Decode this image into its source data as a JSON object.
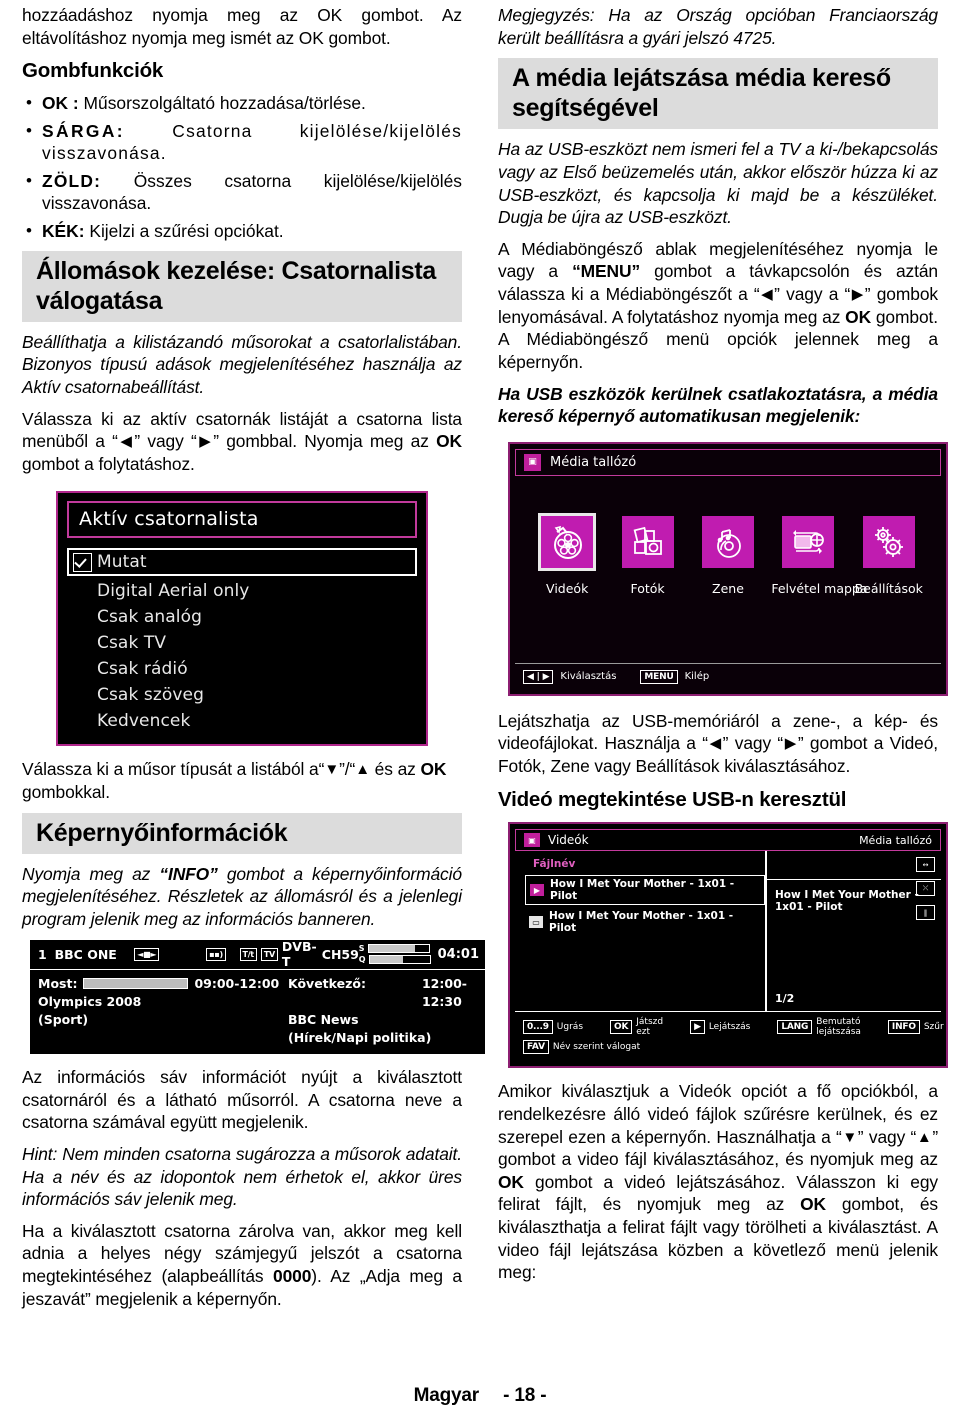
{
  "left": {
    "intro_paragraph": "hozzáadáshoz nyomja meg az OK gombot. Az eltávolításhoz nyomja meg ismét az OK gombot.",
    "button_functions_heading": "Gombfunkciók",
    "button_items": [
      {
        "key": "OK :",
        "text": " Műsorszolgáltató hozzadása/törlése."
      },
      {
        "key": "SÁRGA:",
        "text": " Csatorna kijelölése/kijelölés visszavonása."
      },
      {
        "key": "ZÖLD:",
        "text": " Összes csatorna kijelölése/kijelölés visszavonása."
      },
      {
        "key": "KÉK:",
        "text": " Kijelzi a szűrési opciókat."
      }
    ],
    "section_heading": "Állomások kezelése: Csatornalista válogatása",
    "para_italic_1": "Beállíthatja a kilistázandó műsorokat a csatorlalistában. Bizonyos típusú adások megjelenítéséhez használja az Aktív csatornabeállítást.",
    "para_2_a": "Válassza ki az aktív csatornák listáját a csatorna lista menüből a “",
    "para_2_b": "” vagy “",
    "para_2_c": "” gombbal. Nyomja meg az ",
    "para_2_ok": "OK",
    "para_2_d": " gombot a folytatáshoz.",
    "active_list_screenshot": {
      "title": "Aktív csatornalista",
      "options": [
        {
          "label": "Mutat",
          "selected": true,
          "checked": true
        },
        {
          "label": "Digital Aerial only",
          "selected": false,
          "checked": false
        },
        {
          "label": "Csak analóg",
          "selected": false,
          "checked": false
        },
        {
          "label": "Csak TV",
          "selected": false,
          "checked": false
        },
        {
          "label": "Csak rádió",
          "selected": false,
          "checked": false
        },
        {
          "label": "Csak szöveg",
          "selected": false,
          "checked": false
        },
        {
          "label": "Kedvencek",
          "selected": false,
          "checked": false
        }
      ]
    },
    "para_3_a": "Válassza ki a műsor típusát a listából a“",
    "para_3_b": "”/“",
    "para_3_c": " és az ",
    "para_3_ok": "OK",
    "para_3_d": " gombokkal.",
    "screen_info_heading": "Képernyőinformációk",
    "para_info_a": "Nyomja meg az ",
    "para_info_bold": "“INFO”",
    "para_info_b": " gombot a képernyőinformáció megjelenítéséhez. Részletek az állomásról és a jelenlegi program jelenik meg az információs banneren.",
    "banner_screenshot": {
      "channel_number": "1",
      "channel_name": "BBC ONE",
      "icons": [
        "stereo-icon",
        "subtitle-icon",
        "teletext-icon",
        "tv-icon"
      ],
      "teletext_label": "T/t",
      "tv_label": "TV",
      "broadcast_type": "DVB-T",
      "channel_id": "CH59",
      "signal_label": "S",
      "quality_label": "Q",
      "signal_percent": 78,
      "quality_percent": 55,
      "clock": "04:01",
      "now_label": "Most:",
      "now_time": "09:00-12:00",
      "now_title": "Olympics 2008",
      "now_genre": "(Sport)",
      "next_label": "Következő:",
      "next_time": "12:00-12:30",
      "next_title": "BBC News",
      "next_genre": "(Hírek/Napi politika)",
      "progress_percent": 100
    },
    "para_4": "Az információs sáv információt nyújt a kiválasztott csatornáról és a látható műsorról. A csatorna neve a csatorna számával együtt megjelenik.",
    "para_hint": "Hint: Nem minden csatorna sugározza a műsorok adatait. Ha a név és az idopontok nem érhetok el, akkor üres információs sáv jelenik meg.",
    "para_5_a": "Ha a kiválasztott csatorna zárolva van, akkor meg kell adnia a helyes négy számjegyű jelszót a csatorna megtekintéséhez (alapbeállítás ",
    "para_5_code": "0000",
    "para_5_b": "). Az „Adja meg a jeszavát” megjelenik a képernyőn."
  },
  "right": {
    "note_paragraph": "Megjegyzés: Ha az Ország opcióban Franciaország került beállításra a gyári jelszó 4725.",
    "section_heading": "A média lejátszása média kereső segítségével",
    "para_italic_1": "Ha az USB-eszközt nem ismeri fel a TV a ki-/bekapcsolás vagy az Első beüzemelés után, akkor először húzza ki az USB-eszközt, és kapcsolja ki majd be a készüléket. Dugja be újra az USB-eszközt.",
    "para_2_a": "A Médiaböngésző ablak megjelenítéséhez nyomja le vagy a ",
    "para_2_menu": "“MENU”",
    "para_2_b": " gombot a távkapcsolón és aztán válassza ki a Médiaböngészőt a “",
    "para_2_c": "” vagy a “",
    "para_2_d": "” gombok lenyomásával. A folytatáshoz nyomja meg az ",
    "para_2_ok": "OK",
    "para_2_e": " gombot. A Médiaböngésző menü opciók jelennek meg a képernyőn.",
    "para_bold_italic": "Ha USB eszközök kerülnek csatlakoztatásra, a média kereső képernyő automatikusan megjelenik:",
    "media_browser_screenshot": {
      "title": "Média tallózó",
      "items": [
        {
          "label": "Videók",
          "icon": "film-reel-icon",
          "selected": true
        },
        {
          "label": "Fotók",
          "icon": "camera-icon",
          "selected": false
        },
        {
          "label": "Zene",
          "icon": "music-disc-icon",
          "selected": false
        },
        {
          "label": "Felvétel mappa",
          "icon": "recording-folder-icon",
          "selected": false
        },
        {
          "label": "Beállítások",
          "icon": "gears-icon",
          "selected": false
        }
      ],
      "footer": [
        {
          "key": "◀ | ▶",
          "label": "Kiválasztás"
        },
        {
          "key": "MENU",
          "label": "Kilép"
        }
      ]
    },
    "para_3_a": "Lejátszhatja az USB-memóriáról a zene-, a kép- és videofájlokat. Használja a “",
    "para_3_b": "” vagy “",
    "para_3_c": "” gombot a Videó, Fotók, Zene vagy Beállítások kiválasztásához.",
    "sub_heading": "Videó megtekintése USB-n keresztül",
    "video_browser_screenshot": {
      "title": "Videók",
      "header_right": "Média tallózó",
      "column_header": "Fájlnév",
      "rows": [
        {
          "name": "How I Met Your Mother - 1x01 - Pilot",
          "icon": "video-file-icon",
          "selected": true
        },
        {
          "name": "How I Met Your Mother - 1x01 - Pilot",
          "icon": "subtitle-file-icon",
          "selected": false
        }
      ],
      "preview_filename": "How I Met Your Mother - 1x01 - Pilot",
      "pager": "1/2",
      "side_icons": [
        "aspect-icon",
        "shuffle-icon",
        "loop-icon"
      ],
      "footer": [
        {
          "key": "0...9",
          "label": "Ugrás"
        },
        {
          "key": "OK",
          "label": "Játszd ezt"
        },
        {
          "key": "▶",
          "label": "Lejátszás"
        },
        {
          "key": "LANG",
          "label": "Bemutató lejátszása"
        },
        {
          "key": "INFO",
          "label": "Szűr"
        }
      ],
      "footer_second": [
        {
          "key": "FAV",
          "label": "Név szerint válogat"
        }
      ]
    },
    "para_4_a": "Amikor kiválasztjuk a Videók opciót a fő opciókból, a rendelkezésre álló videó fájlok szűrésre kerülnek, és ez szerepel ezen a képernyőn. Használhatja a “",
    "para_4_b": "” vagy “",
    "para_4_c": "” gombot a video fájl kiválasztásához, és nyomjuk meg az ",
    "para_4_ok1": "OK",
    "para_4_d": " gombot a videó lejátszásához. Válasszon ki egy felirat fájlt, és nyomjuk meg az ",
    "para_4_ok2": "OK",
    "para_4_e": " gombot, és kiválaszthatja a felirat fájlt vagy törölheti a kiválasztást. A video fájl lejátszása közben a követlező menü jelenik meg:"
  },
  "footer": {
    "language": "Magyar",
    "page": "- 18 -"
  },
  "colors": {
    "accent_magenta": "#c01cb0",
    "border_magenta": "#8d1f72",
    "heading_bg": "#dcdcdc"
  }
}
